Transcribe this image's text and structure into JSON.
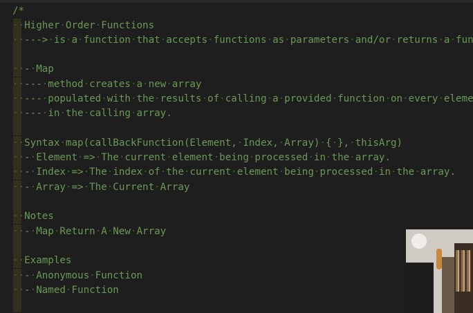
{
  "editor": {
    "lines": [
      {
        "text": "/*",
        "guide": false
      },
      {
        "text": "··Higher·Order·Functions",
        "guide": true
      },
      {
        "text": "··--->·is·a·function·that·accepts·functions·as·parameters·and/or·returns·a·functio",
        "guide": true
      },
      {
        "text": "",
        "guide": true
      },
      {
        "text": "··-·Map",
        "guide": true
      },
      {
        "text": "··---·method·creates·a·new·array",
        "guide": true
      },
      {
        "text": "··---·populated·with·the·results·of·calling·a·provided·function·on·every·element",
        "guide": true
      },
      {
        "text": "··---·in·the·calling·array.",
        "guide": true
      },
      {
        "text": "",
        "guide": true
      },
      {
        "text": "··Syntax·map(callBackFunction(Element,·Index,·Array)·{·},·thisArg)",
        "guide": true
      },
      {
        "text": "··-·Element·=>·The·current·element·being·processed·in·the·array.",
        "guide": true
      },
      {
        "text": "··-·Index·=>·The·index·of·the·current·element·being·processed·in·the·array.",
        "guide": true
      },
      {
        "text": "··-·Array·=>·The·Current·Array",
        "guide": true
      },
      {
        "text": "",
        "guide": true
      },
      {
        "text": "··Notes",
        "guide": true
      },
      {
        "text": "··-·Map·Return·A·New·Array",
        "guide": true
      },
      {
        "text": "",
        "guide": true
      },
      {
        "text": "··Examples",
        "guide": true
      },
      {
        "text": "··-·Anonymous·Function",
        "guide": true
      },
      {
        "text": "··-·Named·Function",
        "guide": true
      }
    ]
  },
  "colors": {
    "background": "#1e1e1e",
    "comment": "#6a9955",
    "indent_guide": "#4a4a1e"
  }
}
